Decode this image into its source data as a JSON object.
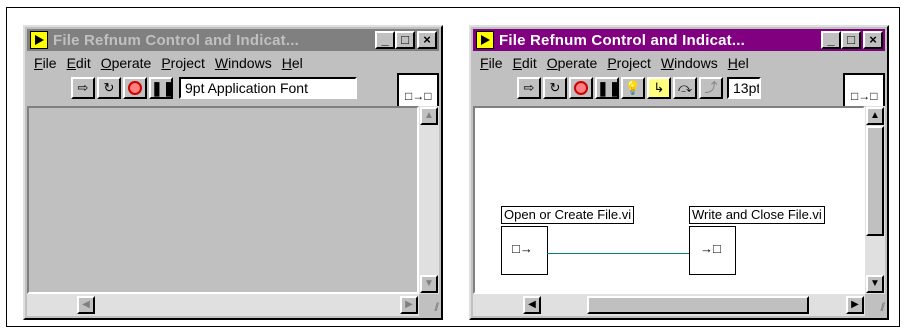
{
  "windows": [
    {
      "id": "panel",
      "title": "File Refnum Control and Indicat...",
      "active": false,
      "titlebar_buttons": [
        "_",
        "□",
        "×"
      ],
      "menu": [
        {
          "accel": "F",
          "rest": "ile"
        },
        {
          "accel": "E",
          "rest": "dit"
        },
        {
          "accel": "O",
          "rest": "perate"
        },
        {
          "accel": "P",
          "rest": "roject"
        },
        {
          "accel": "W",
          "rest": "indows"
        },
        {
          "accel": "H",
          "rest": "el"
        }
      ],
      "toolbar": [
        "run-arrow",
        "run-continuously",
        "abort",
        "pause"
      ],
      "font_selector": "9pt Application Font",
      "connector_glyph": "□→□"
    },
    {
      "id": "diagram",
      "title": "File Refnum Control and Indicat...",
      "active": true,
      "titlebar_buttons": [
        "_",
        "□",
        "×"
      ],
      "menu": [
        {
          "accel": "F",
          "rest": "ile"
        },
        {
          "accel": "E",
          "rest": "dit"
        },
        {
          "accel": "O",
          "rest": "perate"
        },
        {
          "accel": "P",
          "rest": "roject"
        },
        {
          "accel": "W",
          "rest": "indows"
        },
        {
          "accel": "H",
          "rest": "el"
        }
      ],
      "toolbar": [
        "run-arrow",
        "run-continuously",
        "abort",
        "pause",
        "highlight-execution",
        "step-into",
        "step-over",
        "step-out"
      ],
      "font_selector": "13pt",
      "connector_glyph": "□→□",
      "nodes": [
        {
          "label": "Open or Create File.vi",
          "glyph": "□→"
        },
        {
          "label": "Write and Close File.vi",
          "glyph": "→□"
        }
      ]
    }
  ],
  "colors": {
    "inactive_title": "#808080",
    "active_title": "#800080",
    "wire": "#008080"
  }
}
